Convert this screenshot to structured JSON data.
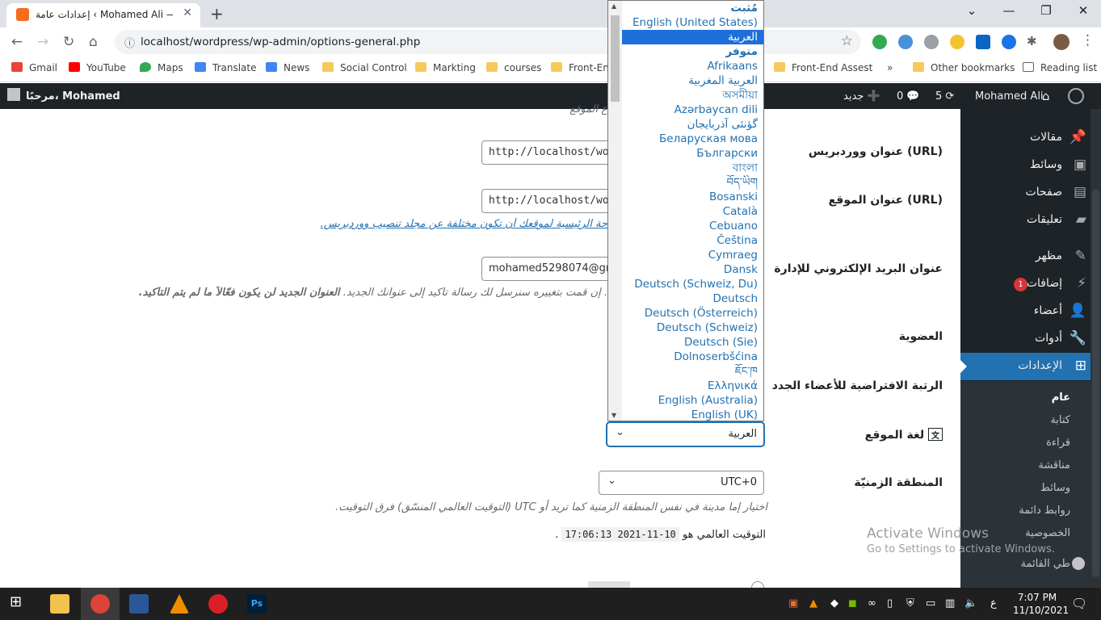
{
  "browser": {
    "tab_title": "إعدادات عامة ‹ Mohamed Ali — و",
    "url": "localhost/wordpress/wp-admin/options-general.php",
    "new_tab": "+",
    "bookmarks": [
      {
        "label": "Gmail",
        "color": "#ea4335"
      },
      {
        "label": "YouTube",
        "color": "#ff0000"
      },
      {
        "label": "Maps",
        "color": "#34a853"
      },
      {
        "label": "Translate",
        "color": "#4285f4"
      },
      {
        "label": "News",
        "color": "#4285f4"
      },
      {
        "label": "Social Control",
        "color": "#f5c95b"
      },
      {
        "label": "Markting",
        "color": "#f5c95b"
      },
      {
        "label": "courses",
        "color": "#f5c95b"
      },
      {
        "label": "Front-End",
        "color": "#f5c95b"
      },
      {
        "label": "Front-End Assest",
        "color": "#f5c95b"
      },
      {
        "label": "»",
        "color": ""
      },
      {
        "label": "Other bookmarks",
        "color": "#f5c95b"
      },
      {
        "label": "Reading list",
        "color": ""
      }
    ]
  },
  "adminbar": {
    "greeting": "مرحبًا، Mohamed",
    "site_name": "Mohamed Ali",
    "updates": "5",
    "comments": "0",
    "new_label": "جديد"
  },
  "sidebar": {
    "items": [
      {
        "label": "مقالات",
        "icon": "pin-icon"
      },
      {
        "label": "وسائط",
        "icon": "media-icon"
      },
      {
        "label": "صفحات",
        "icon": "pages-icon"
      },
      {
        "label": "تعليقات",
        "icon": "comments-icon"
      },
      {
        "label": "مظهر",
        "icon": "appearance-icon"
      },
      {
        "label": "إضافات",
        "icon": "plugins-icon",
        "badge": "1"
      },
      {
        "label": "أعضاء",
        "icon": "users-icon"
      },
      {
        "label": "أدوات",
        "icon": "tools-icon"
      },
      {
        "label": "الإعدادات",
        "icon": "settings-icon"
      }
    ],
    "submenu": [
      "عام",
      "كتابة",
      "قراءة",
      "مناقشة",
      "وسائط",
      "روابط دائمة",
      "الخصوصية"
    ],
    "collapse": "طي القائمة"
  },
  "form": {
    "wp_url_label": "عنوان ووردبريس (URL)",
    "wp_url_value": "http://localhost/wo",
    "site_url_label": "عنوان الموقع (URL)",
    "site_url_value": "http://localhost/wo",
    "site_url_desc": "حة الرئيسية لموقعك أن تكون مختلفة عن مجلّد تنصيب ووردبريس.",
    "email_label": "عنوان البريد الإلكتروني للإدارة",
    "email_value": "mohamed5298074@gm",
    "email_desc_normal": ". إن قمت بتغييره سنرسل لك رسالة تأكيد إلى عنوانك الجديد.",
    "email_desc_bold": "العنوان الجديد لن يكون فعّالاً ما لم يتم التأكيد.",
    "membership_label": "العضوية",
    "role_label": "الرتبة الافتراضية للأعضاء الجدد",
    "language_label": "لغة الموقع",
    "language_value": "العربية",
    "timezone_label": "المنطقة الزمنيّة",
    "timezone_value": "UTC+0",
    "timezone_desc": "اختيار إما مدينة في نفس المنطقة الزمنية كما تريد أو UTC (التوقيت العالمي المنسّق) فرق التوقيت.",
    "utc_label": "التوقيت العالمي هو",
    "utc_value": "10-11-2021 17:06:13",
    "partial_top": "ع الموقع."
  },
  "language_options": [
    {
      "label": "مُثبت",
      "group": true
    },
    {
      "label": "English (United States)"
    },
    {
      "label": "العربية",
      "selected": true
    },
    {
      "label": "متوفر",
      "group": true
    },
    {
      "label": "Afrikaans"
    },
    {
      "label": "العربية المغربية"
    },
    {
      "label": "অসমীয়া"
    },
    {
      "label": "Azərbaycan dili"
    },
    {
      "label": "گؤنئی آذربایجان"
    },
    {
      "label": "Беларуская мова"
    },
    {
      "label": "Български"
    },
    {
      "label": "বাংলা"
    },
    {
      "label": "བོད་ཡིག"
    },
    {
      "label": "Bosanski"
    },
    {
      "label": "Català"
    },
    {
      "label": "Cebuano"
    },
    {
      "label": "Čeština"
    },
    {
      "label": "Cymraeg"
    },
    {
      "label": "Dansk"
    },
    {
      "label": "Deutsch (Schweiz, Du)"
    },
    {
      "label": "Deutsch"
    },
    {
      "label": "Deutsch (Österreich)"
    },
    {
      "label": "Deutsch (Schweiz)"
    },
    {
      "label": "Deutsch (Sie)"
    },
    {
      "label": "Dolnoserbšćina"
    },
    {
      "label": "ཇོང་ཁ"
    },
    {
      "label": "Ελληνικά"
    },
    {
      "label": "English (Australia)"
    },
    {
      "label": "English (UK)"
    }
  ],
  "watermark": {
    "line1": "Activate Windows",
    "line2": "Go to Settings to activate Windows."
  },
  "taskbar": {
    "time": "7:07 PM",
    "date": "11/10/2021",
    "lang": "ع"
  },
  "colors": {
    "accent": "#2271b1",
    "adminbar": "#1d2327",
    "badge": "#d63638"
  }
}
